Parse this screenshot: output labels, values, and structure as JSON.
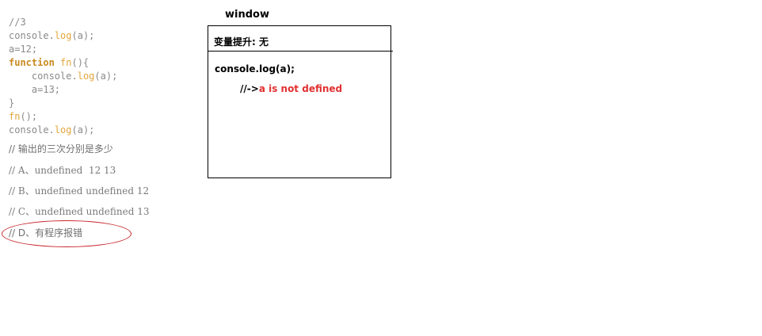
{
  "code": {
    "line1": "//3",
    "line2_obj": "console",
    "line2_dot": ".",
    "line2_fn": "log",
    "line2_args": "(a);",
    "line3": "a=12;",
    "line4_kw": "function",
    "line4_name": " fn",
    "line4_rest": "(){",
    "line5_indent": "    ",
    "line5_obj": "console",
    "line5_dot": ".",
    "line5_fn": "log",
    "line5_args": "(a);",
    "line6": "    a=13;",
    "line7": "}",
    "line8_fn": "fn",
    "line8_rest": "();",
    "line9_obj": "console",
    "line9_dot": ".",
    "line9_fn": "log",
    "line9_args": "(a);"
  },
  "question": "// 输出的三次分别是多少",
  "options": {
    "a": "// A、undefined  12 13",
    "b": "// B、undefined undefined 12",
    "c": "// C、undefined undefined 13",
    "d": "// D、有程序报错"
  },
  "diagram": {
    "title": "window",
    "hoisting": "变量提升: 无",
    "statement": "console.log(a);",
    "result_prefix": "//->",
    "result_error": "a is not defined"
  },
  "colors": {
    "highlight_circle": "#c8282d",
    "error_text": "#e23030",
    "keyword": "#c88a1e",
    "method": "#e2a63d"
  }
}
